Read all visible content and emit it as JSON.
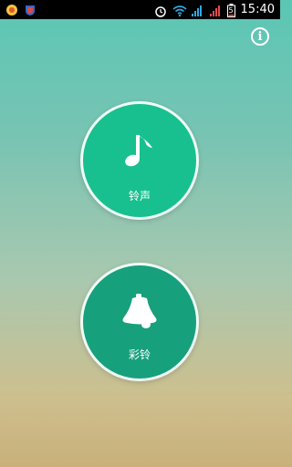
{
  "status_bar": {
    "time": "15:40",
    "battery_percent": "5",
    "icons": [
      "app-icon",
      "app-shield-icon",
      "alarm-icon",
      "wifi-icon",
      "signal-icon",
      "signal-icon",
      "battery-icon"
    ]
  },
  "header": {
    "info_label": "i"
  },
  "buttons": {
    "ringtone_label": "铃声",
    "ringtone_icon": "music-note-icon",
    "colorring_label": "彩铃",
    "colorring_icon": "bell-icon"
  },
  "colors": {
    "ringtone_circle": "#18c08f",
    "colorring_circle": "#17a07c",
    "circle_border": "#eefaf5"
  }
}
